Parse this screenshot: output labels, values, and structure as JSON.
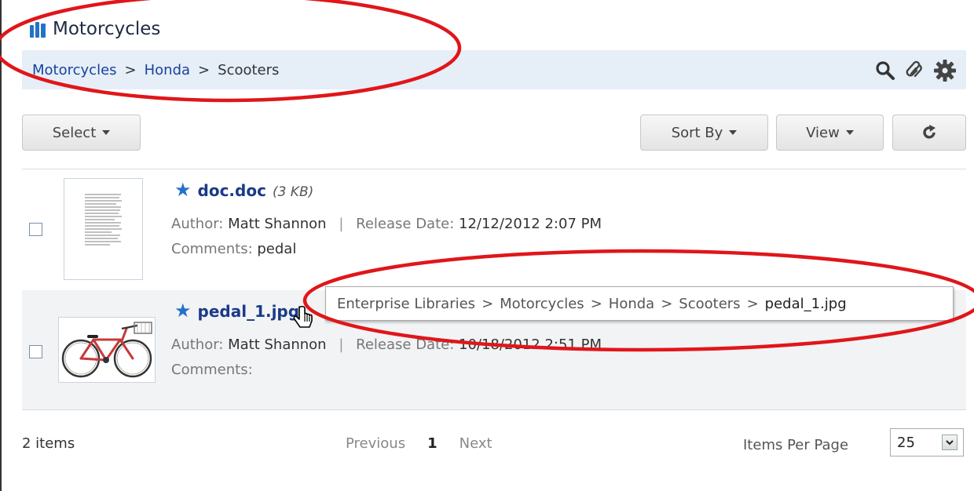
{
  "header": {
    "title": "Motorcycles",
    "icon": "library-books-icon"
  },
  "breadcrumb": {
    "items": [
      {
        "label": "Motorcycles"
      },
      {
        "label": "Honda"
      },
      {
        "label": "Scooters"
      }
    ],
    "separator": ">",
    "actions": [
      "search-icon",
      "link-icon",
      "gear-icon"
    ]
  },
  "toolbar": {
    "select_label": "Select",
    "sort_label": "Sort By",
    "view_label": "View",
    "refresh_icon": "refresh-icon"
  },
  "items": [
    {
      "name": "doc.doc",
      "size": "(3 KB)",
      "author_label": "Author:",
      "author": "Matt Shannon",
      "release_label": "Release Date:",
      "release_date": "12/12/2012 2:07 PM",
      "comments_label": "Comments:",
      "comments": "pedal",
      "thumbnail": "document-thumbnail"
    },
    {
      "name": "pedal_1.jpg",
      "size": "",
      "author_label": "Author:",
      "author": "Matt Shannon",
      "release_label": "Release Date:",
      "release_date": "10/18/2012 2:51 PM",
      "comments_label": "Comments:",
      "comments": "",
      "thumbnail": "bicycle-thumbnail"
    }
  ],
  "tooltip": {
    "path": [
      "Enterprise Libraries",
      "Motorcycles",
      "Honda",
      "Scooters",
      "pedal_1.jpg"
    ],
    "separator": ">"
  },
  "footer": {
    "count": "2 items",
    "previous": "Previous",
    "page": "1",
    "next": "Next",
    "items_per_page_label": "Items Per Page",
    "items_per_page": "25"
  },
  "colors": {
    "accent": "#2472c8",
    "link": "#17439c",
    "annotation": "#e0161a",
    "breadcrumb_bg": "#e6eef8"
  }
}
